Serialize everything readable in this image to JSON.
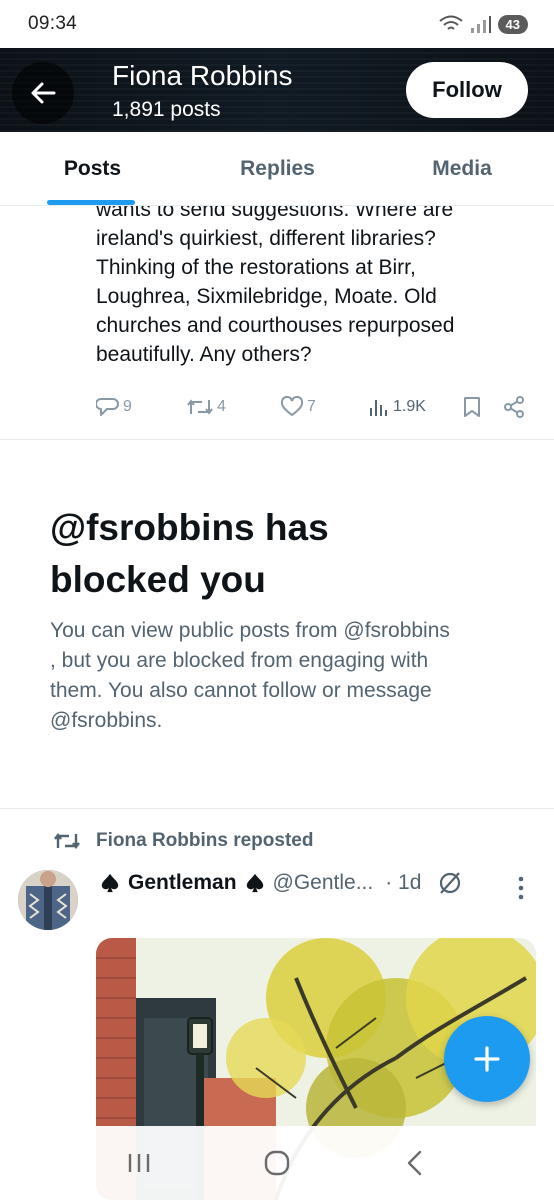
{
  "status_bar": {
    "time": "09:34",
    "battery": "43"
  },
  "header": {
    "name": "Fiona Robbins",
    "post_count": "1,891 posts",
    "follow_label": "Follow"
  },
  "tabs": [
    {
      "label": "Posts",
      "active": true
    },
    {
      "label": "Replies",
      "active": false
    },
    {
      "label": "Media",
      "active": false
    }
  ],
  "tweet": {
    "lines": [
      "wants to send suggestions.  Where are",
      "ireland's quirkiest, different libraries?",
      "Thinking of the restorations at Birr,",
      "Loughrea, Sixmilebridge, Moate. Old",
      "churches and courthouses repurposed",
      "beautifully. Any others?"
    ],
    "replies": "9",
    "reposts": "4",
    "likes": "7",
    "views": "1.9K"
  },
  "blocked": {
    "title_line1": "@fsrobbins has",
    "title_line2": "blocked you",
    "body_line1": "You can view public posts from @fsrobbins",
    "body_line2": ", but you are blocked from engaging with",
    "body_line3": "them. You also cannot follow or message",
    "body_line4": "@fsrobbins."
  },
  "repost": {
    "reposted_by": "Fiona Robbins reposted",
    "author_name": "Gentleman",
    "author_handle": "@Gentle...",
    "time": "· 1d"
  },
  "colors": {
    "accent": "#1d9bf0",
    "text": "#0f1419",
    "muted": "#536471",
    "header_bg": "#0b1117"
  },
  "icons": [
    "back-arrow-icon",
    "reply-icon",
    "repost-icon",
    "like-icon",
    "views-icon",
    "bookmark-icon",
    "share-icon",
    "repost-small-icon",
    "spade-icon",
    "grok-icon",
    "more-icon",
    "plus-icon",
    "recents-icon",
    "home-icon",
    "back-nav-icon"
  ]
}
